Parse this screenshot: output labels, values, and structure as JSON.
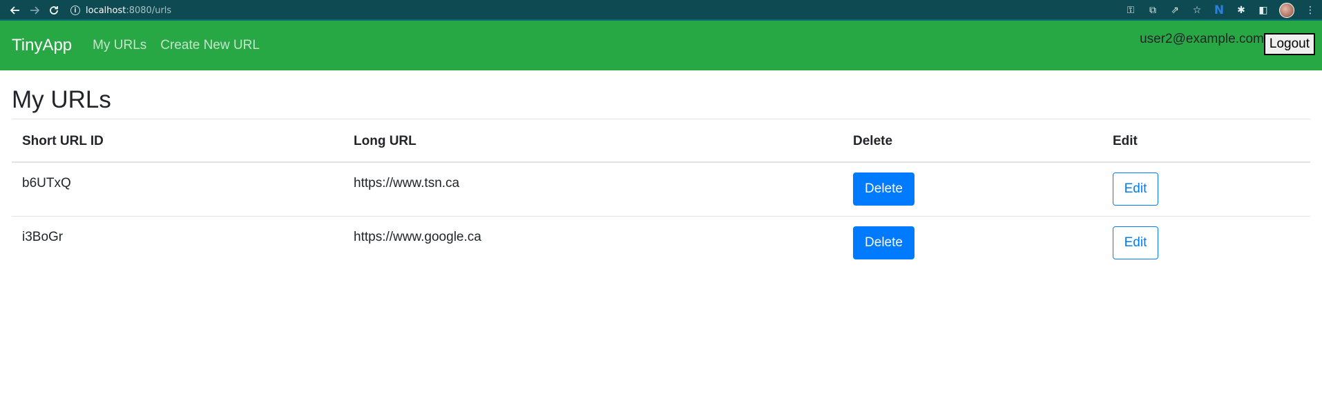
{
  "browser": {
    "url_host": "localhost",
    "url_rest": ":8080/urls"
  },
  "navbar": {
    "brand": "TinyApp",
    "links": [
      "My URLs",
      "Create New URL"
    ],
    "user_email": "user2@example.com",
    "logout_label": "Logout",
    "bg_color": "#28a745"
  },
  "main": {
    "title": "My URLs",
    "table": {
      "headers": [
        "Short URL ID",
        "Long URL",
        "Delete",
        "Edit"
      ],
      "rows": [
        {
          "short_id": "b6UTxQ",
          "long_url": "https://www.tsn.ca",
          "delete_label": "Delete",
          "edit_label": "Edit"
        },
        {
          "short_id": "i3BoGr",
          "long_url": "https://www.google.ca",
          "delete_label": "Delete",
          "edit_label": "Edit"
        }
      ]
    }
  }
}
